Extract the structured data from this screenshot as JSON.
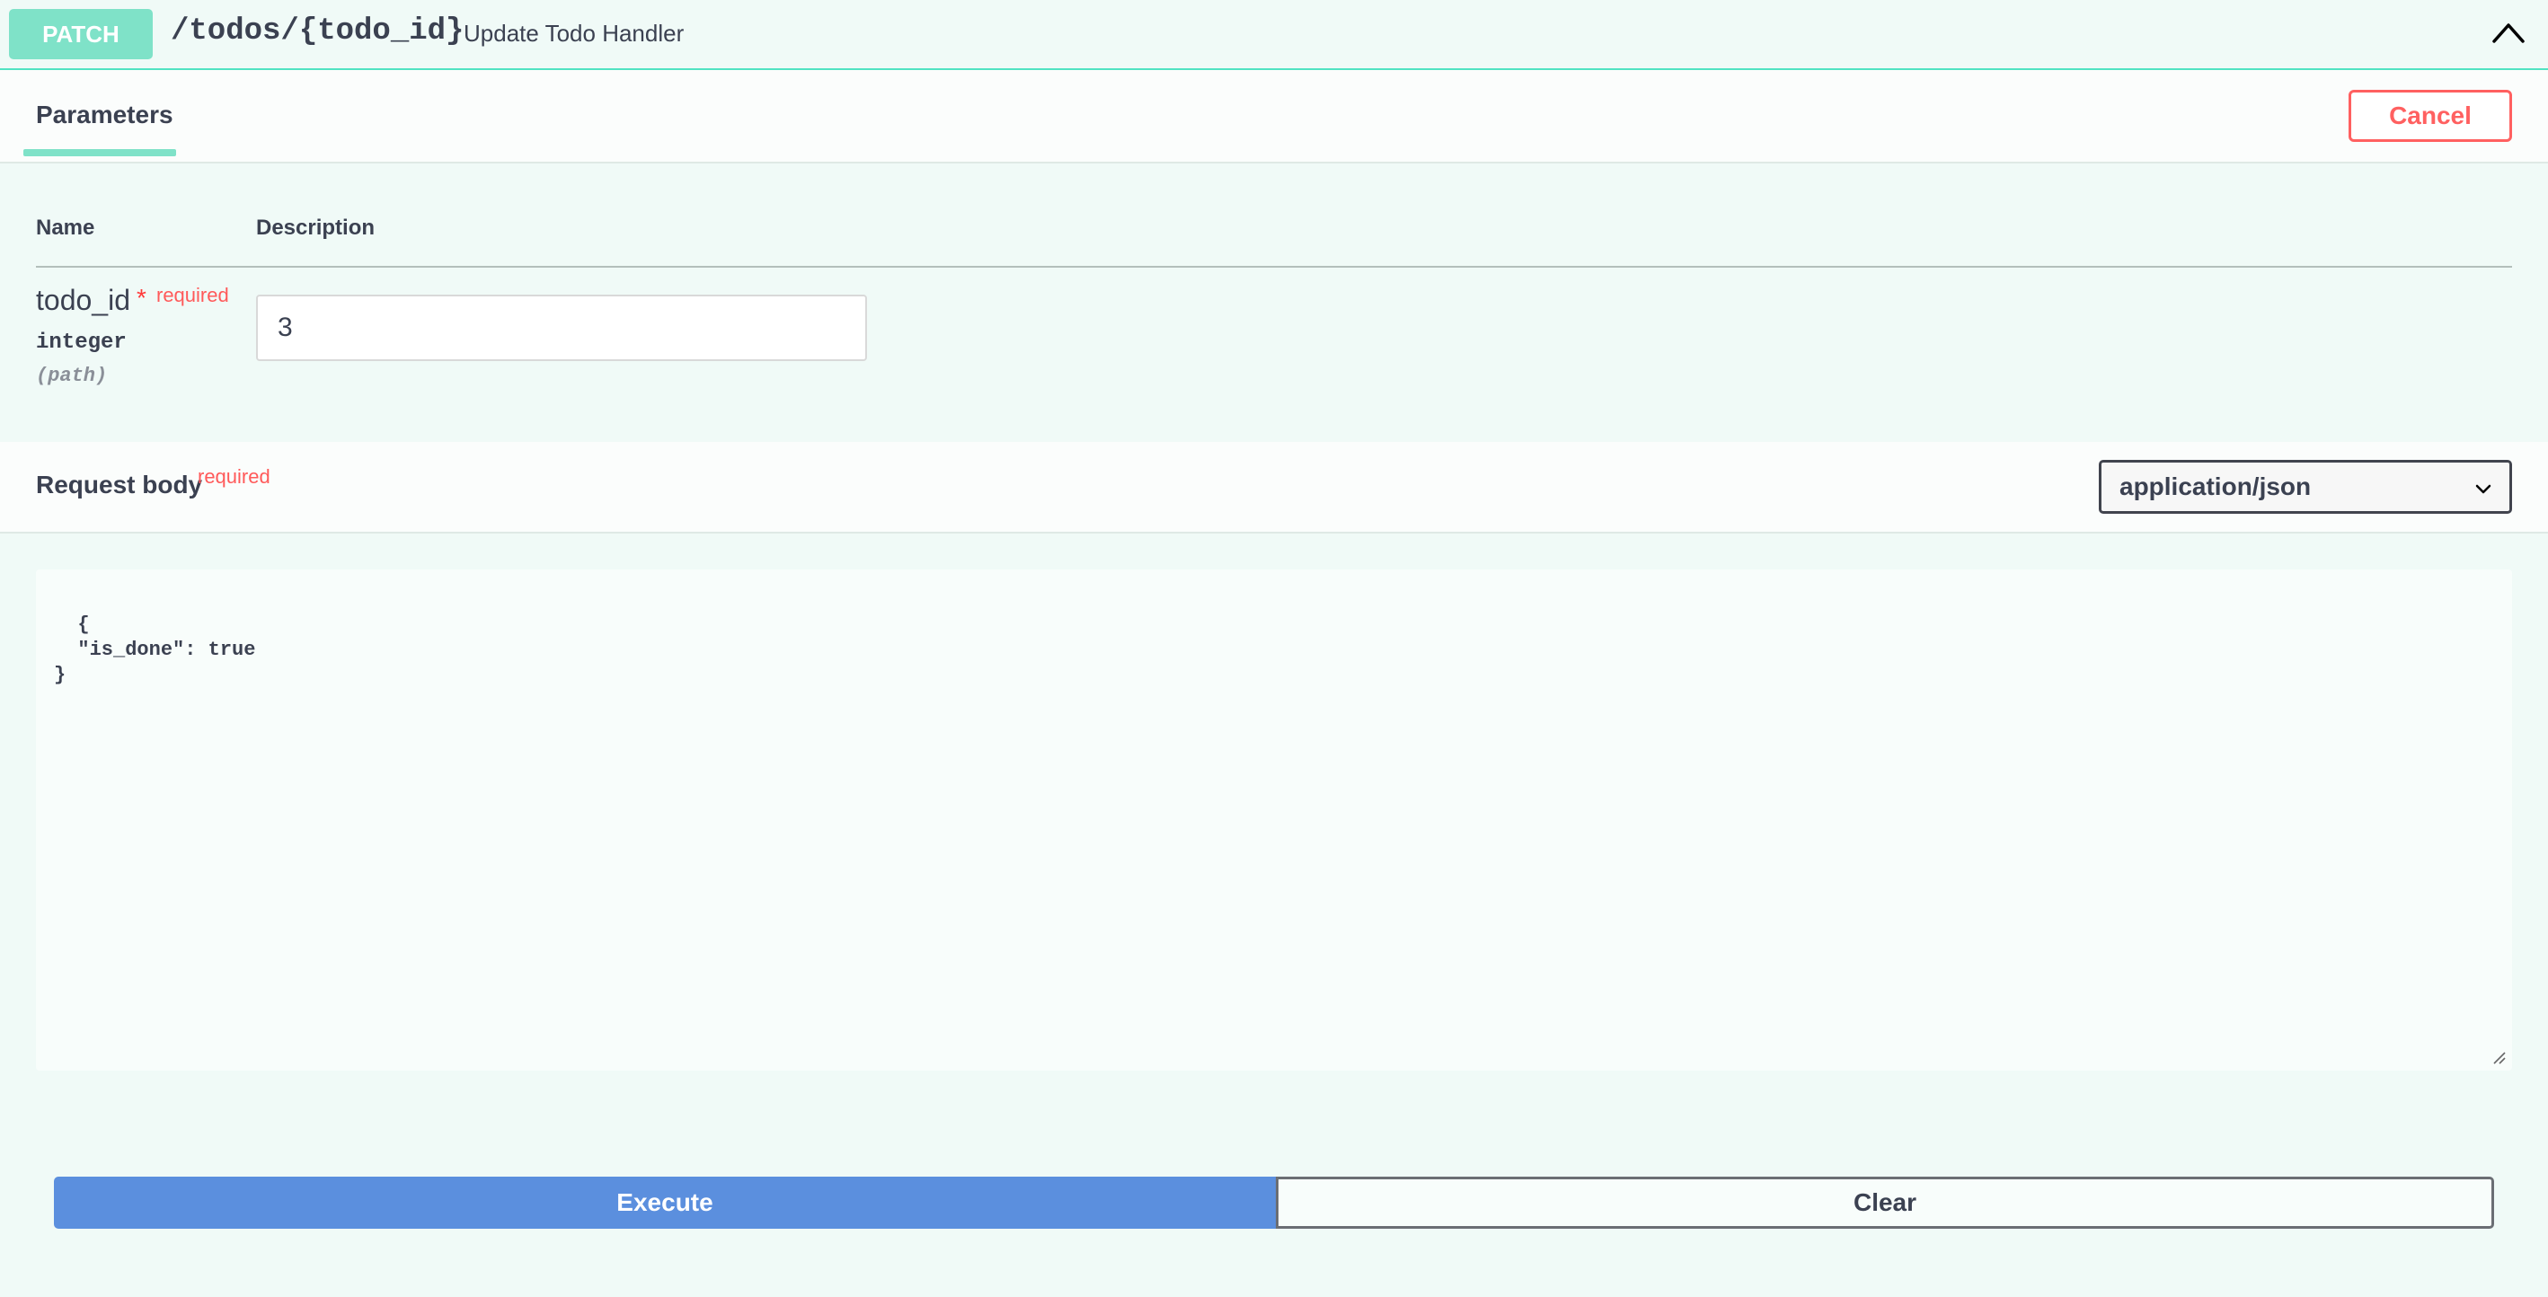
{
  "operation": {
    "method": "PATCH",
    "path": "/todos/{todo_id}",
    "summary": "Update Todo Handler",
    "collapse_icon": "chevron-up-icon"
  },
  "tabs": {
    "parameters_label": "Parameters",
    "cancel_label": "Cancel"
  },
  "parameters": {
    "header_name": "Name",
    "header_description": "Description",
    "items": [
      {
        "name": "todo_id",
        "asterisk": "*",
        "required_label": "required",
        "type": "integer",
        "in": "(path)",
        "value": "3"
      }
    ]
  },
  "request_body": {
    "title": "Request body",
    "required_label": "required",
    "content_type": "application/json",
    "body_text": "{\n  \"is_done\": true\n}"
  },
  "actions": {
    "execute_label": "Execute",
    "clear_label": "Clear"
  },
  "colors": {
    "method_bg": "#7fe2c8",
    "execute_bg": "#5b8fde",
    "cancel_red": "#ff6060"
  }
}
